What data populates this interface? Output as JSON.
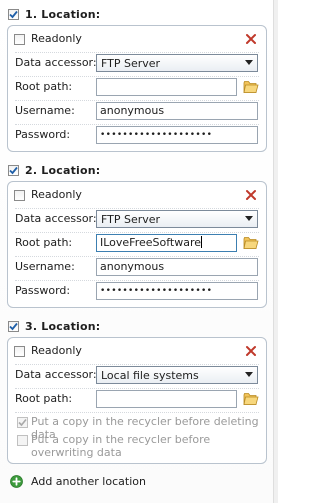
{
  "locations": [
    {
      "header": "1. Location:",
      "enabled": true,
      "readonly_label": "Readonly",
      "fields": {
        "data_accessor_label": "Data accessor:",
        "data_accessor_value": "FTP Server",
        "root_path_label": "Root path:",
        "root_path_value": "",
        "username_label": "Username:",
        "username_value": "anonymous",
        "password_label": "Password:",
        "password_value": "••••••••••••••••••••"
      }
    },
    {
      "header": "2. Location:",
      "enabled": true,
      "readonly_label": "Readonly",
      "fields": {
        "data_accessor_label": "Data accessor:",
        "data_accessor_value": "FTP Server",
        "root_path_label": "Root path:",
        "root_path_value": "ILoveFreeSoftware",
        "username_label": "Username:",
        "username_value": "anonymous",
        "password_label": "Password:",
        "password_value": "••••••••••••••••••••"
      }
    },
    {
      "header": "3. Location:",
      "enabled": true,
      "readonly_label": "Readonly",
      "fields": {
        "data_accessor_label": "Data accessor:",
        "data_accessor_value": "Local file systems",
        "root_path_label": "Root path:",
        "root_path_value": "",
        "recycler_delete_label": "Put a copy in the recycler before deleting data",
        "recycler_overwrite_label": "Put a copy in the recycler before overwriting data"
      }
    }
  ],
  "add_location_label": "Add another location",
  "colors": {
    "remove": "#c0392b",
    "check": "#1f5fa8",
    "add_button": "#3c9a3c",
    "folder": "#e9b84a"
  },
  "icons": [
    "checkmark-icon",
    "remove-icon",
    "chevron-down-icon",
    "folder-icon",
    "add-icon"
  ]
}
